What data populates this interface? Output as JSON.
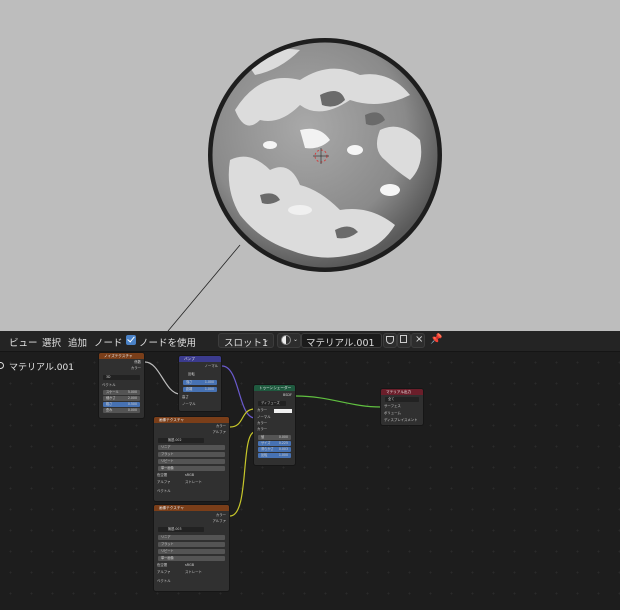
{
  "header": {
    "menu": [
      "ビュー",
      "選択",
      "追加",
      "ノード"
    ],
    "use_nodes_label": "ノードを使用",
    "slot": "スロット1",
    "material_name": "マテリアル.001"
  },
  "breadcrumb": "マテリアル.001",
  "nodes": {
    "noise": {
      "title": "ノイズテクスチャ",
      "out_factor": "係数",
      "out_color": "カラー",
      "dimension": "3D",
      "in_vector": "ベクトル",
      "scale": "スケール",
      "scale_v": "5.000",
      "detail": "細かさ",
      "detail_v": "2.000",
      "roughness": "粗さ",
      "roughness_v": "0.500",
      "distortion": "歪み",
      "distortion_v": "0.000"
    },
    "bump": {
      "title": "バンプ",
      "out_normal": "ノーマル",
      "invert": "反転",
      "strength": "強さ",
      "strength_v": "1.000",
      "distance": "距離",
      "distance_v": "1.000",
      "height": "高さ",
      "in_normal": "ノーマル"
    },
    "toon": {
      "title": "トゥーンシェーダー",
      "out": "BSDF",
      "mode": "ディフューズ",
      "in_color": "カラー",
      "in_normal": "ノーマル",
      "size": "サイズ",
      "size_v": "0.225",
      "smooth": "滑らかさ",
      "smooth_v": "0.003",
      "ip": "IP",
      "ip_v": "1.000",
      "ip2": "反転",
      "ip2_v": "1.000",
      "color": "カラー",
      "normal": "ノーマル",
      "color2": "カラー",
      "x": "値",
      "x_v": "0.000"
    },
    "output": {
      "title": "マテリアル出力",
      "target": "全て",
      "surface": "サーフェス",
      "volume": "ボリューム",
      "displacement": "ディスプレイスメント"
    },
    "img1": {
      "title": "画像テクスチャ",
      "out_color": "カラー",
      "out_alpha": "アルファ",
      "image": "無題.002",
      "linear": "リニア",
      "flat": "フラット",
      "repeat": "リピート",
      "single": "単一画像",
      "colorspace": "色空間",
      "colorspace_v": "sRGB",
      "alpha": "アルファ",
      "alpha_v": "ストレート",
      "vector": "ベクトル"
    },
    "img2": {
      "title": "画像テクスチャ",
      "out_color": "カラー",
      "out_alpha": "アルファ",
      "image": "無題.003",
      "linear": "リニア",
      "flat": "フラット",
      "repeat": "リピート",
      "single": "単一画像",
      "colorspace": "色空間",
      "colorspace_v": "sRGB",
      "alpha": "アルファ",
      "alpha_v": "ストレート",
      "vector": "ベクトル"
    }
  },
  "colors": {
    "accent": "#4a82c7",
    "noise_header": "#7a3e19",
    "bump_header": "#3b3b8e",
    "toon_header": "#1f5a3f",
    "output_header": "#6b1e2a",
    "image_header": "#7a3e19",
    "link_yellow": "#c7c72a",
    "link_green": "#60c040",
    "link_purple": "#6a5acd",
    "link_gray": "#bdbdbd"
  }
}
